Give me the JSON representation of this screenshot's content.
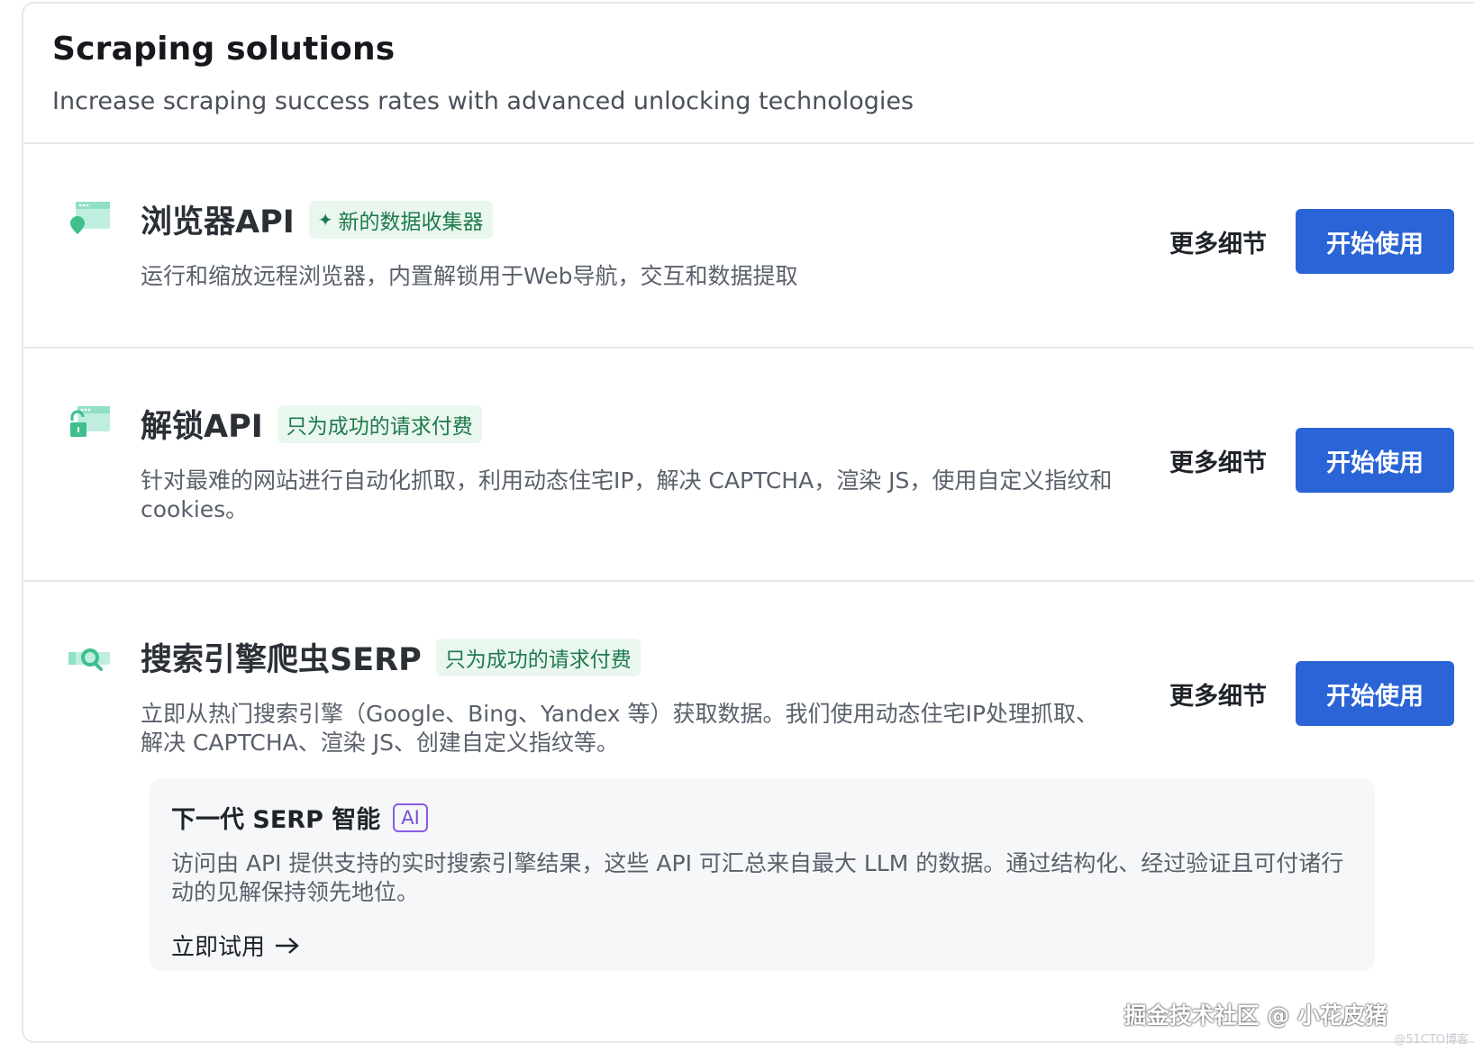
{
  "header": {
    "title": "Scraping solutions",
    "subtitle": "Increase scraping success rates with advanced unlocking technologies"
  },
  "products": [
    {
      "title": "浏览器API",
      "tag": "新的数据收集器",
      "description": "运行和缩放远程浏览器，内置解锁用于Web导航，交互和数据提取",
      "details_label": "更多细节",
      "start_label": "开始使用",
      "icon": "browser-location-icon"
    },
    {
      "title": "解锁API",
      "tag": "只为成功的请求付费",
      "description": "针对最难的网站进行自动化抓取，利用动态住宅IP，解决 CAPTCHA，渲染 JS，使用自定义指纹和 cookies。",
      "details_label": "更多细节",
      "start_label": "开始使用",
      "icon": "browser-unlock-icon"
    },
    {
      "title": "搜索引擎爬虫SERP",
      "tag": "只为成功的请求付费",
      "description": "立即从热门搜索引擎（Google、Bing、Yandex 等）获取数据。我们使用动态住宅IP处理抓取、解决 CAPTCHA、渲染 JS、创建自定义指纹等。",
      "details_label": "更多细节",
      "start_label": "开始使用",
      "icon": "search-engine-icon"
    }
  ],
  "serp_ai": {
    "title": "下一代 SERP 智能",
    "badge": "AI",
    "description": "访问由 API 提供支持的实时搜索引擎结果，这些 API 可汇总来自最大 LLM 的数据。通过结构化、经过验证且可付诸行动的见解保持领先地位。",
    "try_label": "立即试用",
    "try_icon": "arrow-right-icon"
  },
  "watermark": {
    "main": "掘金技术社区 @ 小花皮猪",
    "small": "@51CTO博客"
  },
  "colors": {
    "accent": "#2a64d6",
    "tag_bg": "#eaf7ef",
    "tag_text": "#1f7a4d",
    "icon_teal": "#6fd6b8",
    "ai_purple": "#8a5ce6"
  }
}
